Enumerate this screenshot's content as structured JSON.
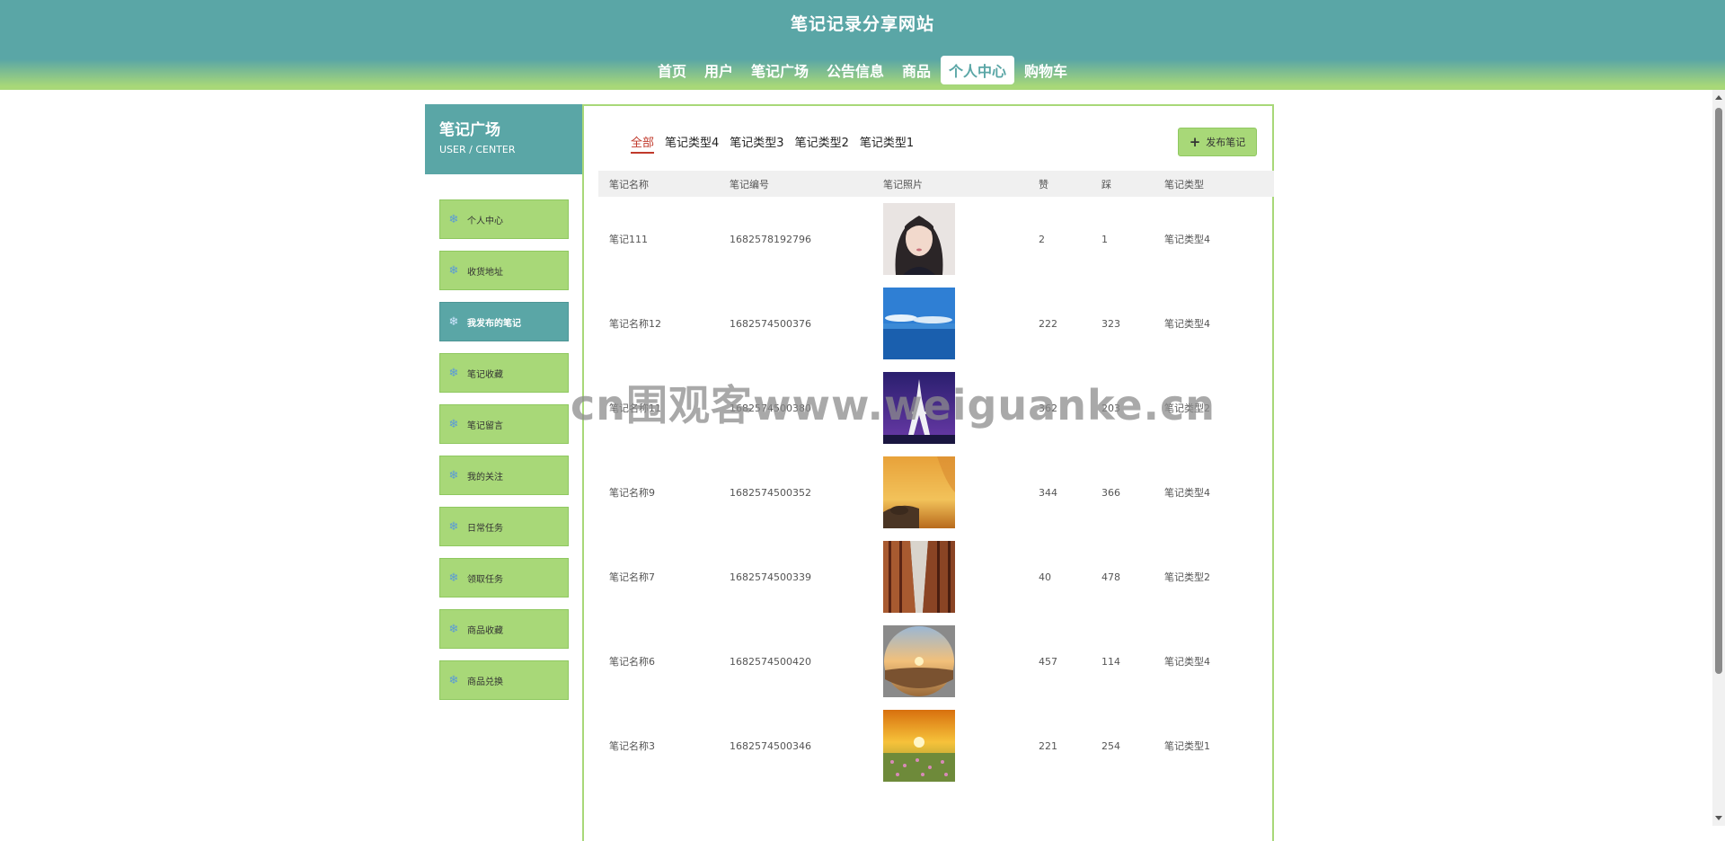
{
  "site": {
    "title": "笔记记录分享网站"
  },
  "nav": [
    {
      "label": "首页"
    },
    {
      "label": "用户"
    },
    {
      "label": "笔记广场"
    },
    {
      "label": "公告信息"
    },
    {
      "label": "商品"
    },
    {
      "label": "个人中心",
      "active": true
    },
    {
      "label": "购物车"
    }
  ],
  "sidebar": {
    "title": "笔记广场",
    "subtitle": "USER / CENTER",
    "items": [
      {
        "label": "个人中心"
      },
      {
        "label": "收货地址"
      },
      {
        "label": "我发布的笔记",
        "active": true
      },
      {
        "label": "笔记收藏"
      },
      {
        "label": "笔记留言"
      },
      {
        "label": "我的关注"
      },
      {
        "label": "日常任务"
      },
      {
        "label": "领取任务"
      },
      {
        "label": "商品收藏"
      },
      {
        "label": "商品兑换"
      }
    ]
  },
  "tabs": [
    {
      "label": "全部",
      "active": true
    },
    {
      "label": "笔记类型4"
    },
    {
      "label": "笔记类型3"
    },
    {
      "label": "笔记类型2"
    },
    {
      "label": "笔记类型1"
    }
  ],
  "publish_label": "发布笔记",
  "table": {
    "headers": [
      "笔记名称",
      "笔记编号",
      "笔记照片",
      "赞",
      "踩",
      "笔记类型"
    ],
    "rows": [
      {
        "name": "笔记111",
        "code": "1682578192796",
        "photo": "portrait-photo",
        "up": "2",
        "down": "1",
        "type": "笔记类型4"
      },
      {
        "name": "笔记名称12",
        "code": "1682574500376",
        "photo": "sea-sky-photo",
        "up": "222",
        "down": "323",
        "type": "笔记类型4"
      },
      {
        "name": "笔记名称11",
        "code": "1682574500380",
        "photo": "eiffel-tower-photo",
        "up": "362",
        "down": "203",
        "type": "笔记类型2"
      },
      {
        "name": "笔记名称9",
        "code": "1682574500352",
        "photo": "sunset-rocks-photo",
        "up": "344",
        "down": "366",
        "type": "笔记类型4"
      },
      {
        "name": "笔记名称7",
        "code": "1682574500339",
        "photo": "corridor-photo",
        "up": "40",
        "down": "478",
        "type": "笔记类型2"
      },
      {
        "name": "笔记名称6",
        "code": "1682574500420",
        "photo": "desert-globe-photo",
        "up": "457",
        "down": "114",
        "type": "笔记类型4"
      },
      {
        "name": "笔记名称3",
        "code": "1682574500346",
        "photo": "flower-field-sunset-photo",
        "up": "221",
        "down": "254",
        "type": "笔记类型1"
      }
    ]
  },
  "watermark": "cn围观客www.weiguanke.cn"
}
